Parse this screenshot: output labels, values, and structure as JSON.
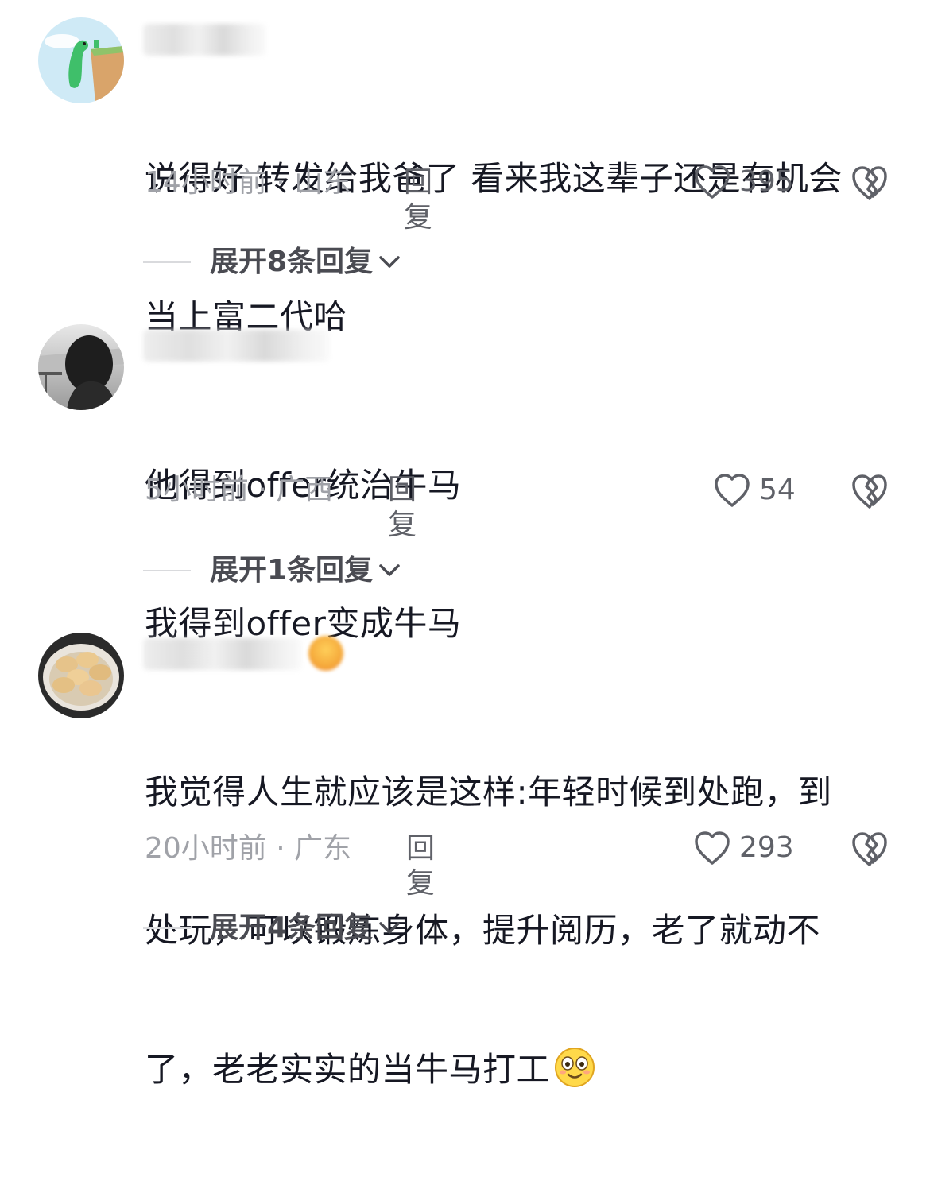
{
  "comments": [
    {
      "text_lines": [
        "说得好 转发给我爸了 看来我这辈子还是有机会",
        "当上富二代哈"
      ],
      "time": "14小时前",
      "location": "山东",
      "reply_label": "回复",
      "likes": "395",
      "expand_label": "展开8条回复"
    },
    {
      "text_lines": [
        "他得到offer统治牛马",
        "我得到offer变成牛马"
      ],
      "time": "5小时前",
      "location": "广西",
      "reply_label": "回复",
      "likes": "54",
      "expand_label": "展开1条回复"
    },
    {
      "text_lines": [
        "我觉得人生就应该是这样:年轻时候到处跑，到",
        "处玩，可以锻炼身体，提升阅历，老了就动不",
        "了，老老实实的当牛马打工"
      ],
      "time": "20小时前",
      "location": "广东",
      "reply_label": "回复",
      "likes": "293",
      "expand_label": "展开4条回复"
    }
  ],
  "meta_separator": " · ",
  "colors": {
    "text": "#161823",
    "meta": "#a0a2a8",
    "reply": "#5f6168",
    "icon": "#5f6168"
  },
  "icons": {
    "like": "heart-outline-icon",
    "dislike": "broken-heart-icon",
    "expand": "chevron-down-icon",
    "emoji": "smiling-face-emoji"
  }
}
